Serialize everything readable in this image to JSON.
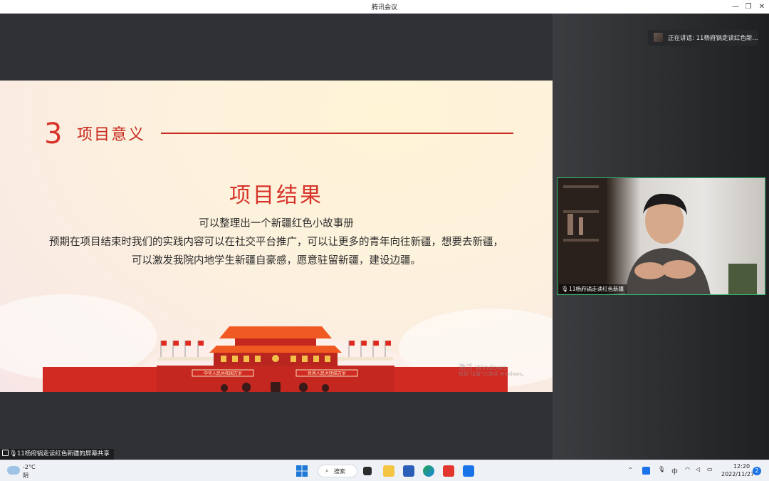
{
  "window": {
    "title": "腾讯会议",
    "minimize_glyph": "—",
    "restore_glyph": "❐",
    "close_glyph": "✕"
  },
  "speaking": {
    "text": "正在讲话: 11杨府锅走读红色新..."
  },
  "slide": {
    "section_number": "3",
    "section_title": "项目意义",
    "headline": "项目结果",
    "lines": [
      "可以整理出一个新疆红色小故事册",
      "预期在项目结束时我们的实践内容可以在社交平台推广，可以让更多的青年向往新疆，想要去新疆，",
      "可以激发我院内地学生新疆自豪感，愿意驻留新疆，建设边疆。"
    ],
    "banner_left": "中华人民共和国万岁",
    "banner_right": "世界人民大团结万岁",
    "watermark_line1": "激活 Windows",
    "watermark_line2": "转到\"设置\"以激活 Windows。",
    "colors": {
      "accent": "#d7332a",
      "gate_red": "#c8281e",
      "roof": "#f05a22"
    }
  },
  "video": {
    "label": "11杨府锅走读红色新疆"
  },
  "share": {
    "label": "11杨府锅走读红色新疆的屏幕共享"
  },
  "taskbar": {
    "weather_temp": "-2°C",
    "weather_desc": "阴",
    "search_label": "搜索",
    "ime": "中",
    "time": "12:20",
    "date": "2022/11/27",
    "notifications": "2",
    "icons": [
      "windows-start-icon",
      "search-icon",
      "task-view-icon",
      "file-explorer-icon",
      "word-icon",
      "edge-icon",
      "wps-icon",
      "tencent-meeting-icon"
    ]
  }
}
